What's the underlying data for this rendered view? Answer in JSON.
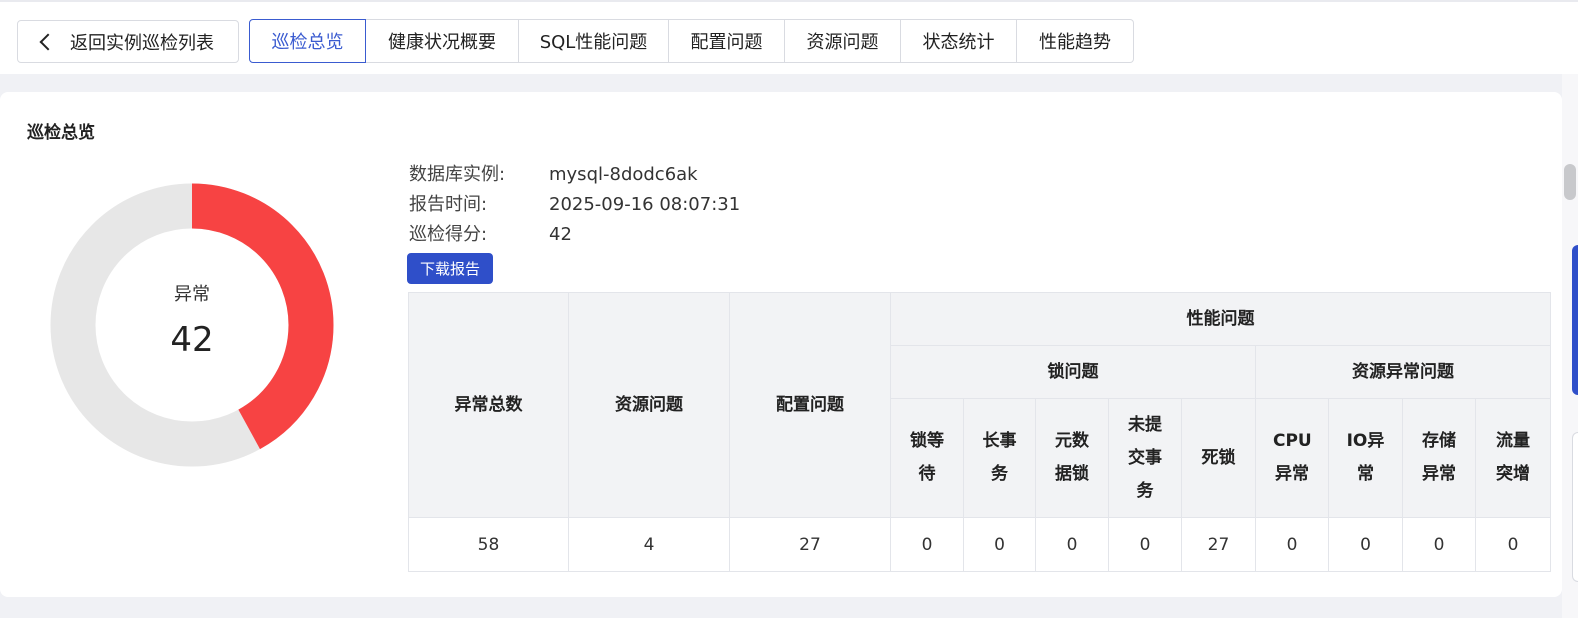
{
  "nav": {
    "back_label": "返回实例巡检列表",
    "tabs": [
      {
        "label": "巡检总览",
        "active": true
      },
      {
        "label": "健康状况概要",
        "active": false
      },
      {
        "label": "SQL性能问题",
        "active": false
      },
      {
        "label": "配置问题",
        "active": false
      },
      {
        "label": "资源问题",
        "active": false
      },
      {
        "label": "状态统计",
        "active": false
      },
      {
        "label": "性能趋势",
        "active": false
      }
    ]
  },
  "overview": {
    "title": "巡检总览",
    "gauge": {
      "label": "异常",
      "value": "42",
      "fraction": 0.42,
      "fill_color": "#f74343",
      "track_color": "#e7e7e7"
    },
    "info": [
      {
        "key": "数据库实例:",
        "value": "mysql-8dodc6ak"
      },
      {
        "key": "报告时间:",
        "value": "2025-09-16 08:07:31"
      },
      {
        "key": "巡检得分:",
        "value": "42"
      }
    ],
    "download_label": "下载报告",
    "accent_color": "#2f4fc9"
  },
  "table": {
    "h_total": "异常总数",
    "h_resource": "资源问题",
    "h_config": "配置问题",
    "h_perf": "性能问题",
    "h_lock": "锁问题",
    "h_res_abn": "资源异常问题",
    "lock_cols": [
      "锁等待",
      "长事务",
      "元数据锁",
      "未提交事务",
      "死锁"
    ],
    "res_cols": [
      "CPU异常",
      "IO异常",
      "存储异常",
      "流量突增"
    ],
    "values": [
      "58",
      "4",
      "27",
      "0",
      "0",
      "0",
      "0",
      "27",
      "0",
      "0",
      "0",
      "0"
    ]
  }
}
